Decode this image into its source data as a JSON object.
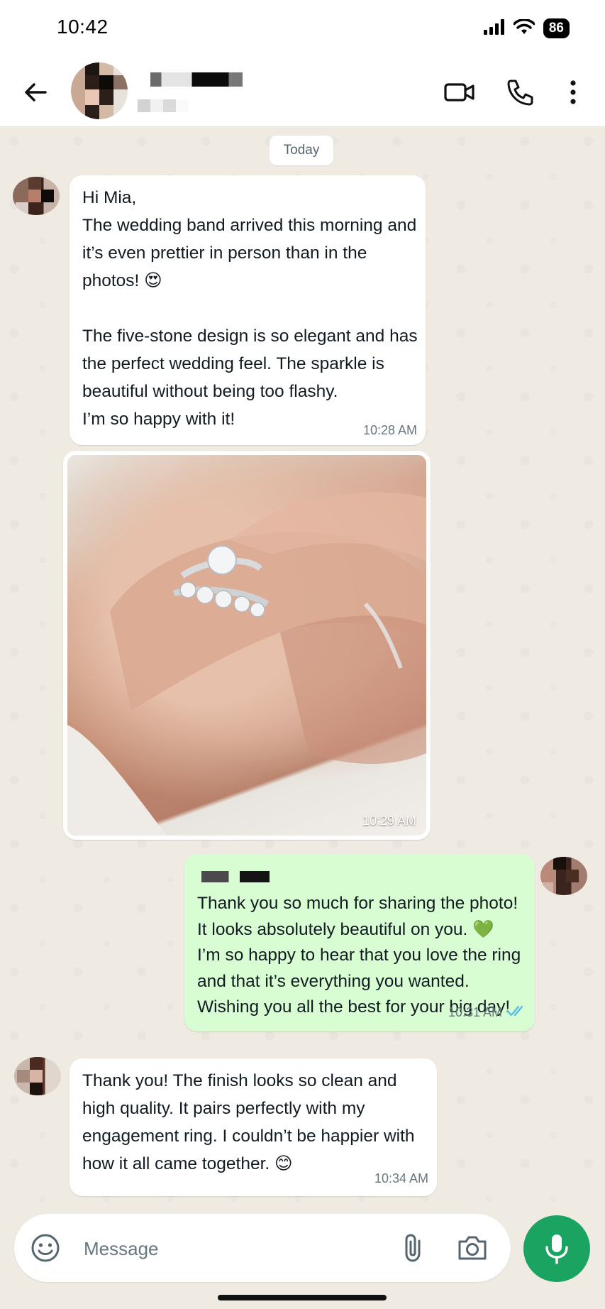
{
  "status_bar": {
    "time": "10:42",
    "battery": "86"
  },
  "header": {
    "icons": [
      "back-arrow-icon",
      "video-call-icon",
      "phone-icon",
      "more-vertical-icon"
    ]
  },
  "chat": {
    "date_label": "Today",
    "messages": [
      {
        "direction": "incoming",
        "text": "Hi Mia,\nThe wedding band arrived this morning and it’s even prettier in person than in the photos! 😍\n\nThe five-stone design is so elegant and has the perfect wedding feel. The sparkle is beautiful without being too flashy.\nI’m so happy with it!",
        "time": "10:28 AM"
      },
      {
        "direction": "incoming",
        "type": "photo",
        "time": "10:29 AM"
      },
      {
        "direction": "outgoing",
        "text": "Thank you so much for sharing the photo!\nIt looks absolutely beautiful on you. 💚\nI’m so happy to hear that you love the ring and that it’s everything you wanted.\nWishing you all the best for your big day!",
        "time": "10:31 AM",
        "status_icon": "double-check-icon"
      },
      {
        "direction": "incoming",
        "text": "Thank you! The finish looks so clean and high quality. It pairs perfectly with my engagement ring. I couldn’t be happier with how it all came together. 😊",
        "time": "10:34 AM"
      }
    ]
  },
  "composer": {
    "placeholder": "Message",
    "value": "",
    "icons": [
      "emoji-icon",
      "paperclip-icon",
      "camera-icon",
      "microphone-icon"
    ]
  },
  "colors": {
    "chat_background": "#efeae2",
    "incoming_bubble": "#ffffff",
    "outgoing_bubble": "#d9fdd3",
    "accent_green": "#1aa361",
    "read_check_blue": "#53bdeb"
  }
}
